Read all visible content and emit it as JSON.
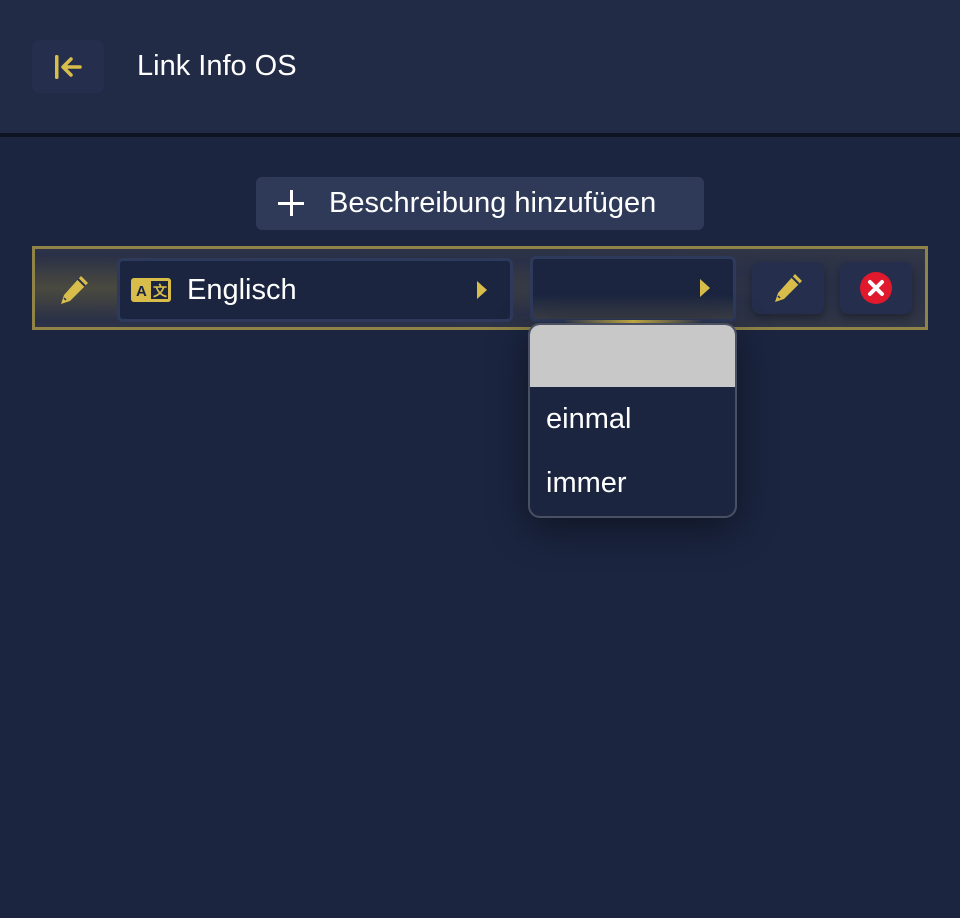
{
  "header": {
    "title": "Link Info OS",
    "back_icon": "collapse-left-arrow-icon"
  },
  "toolbar": {
    "add_description_label": "Beschreibung hinzufügen"
  },
  "entry": {
    "language": "Englisch",
    "language_icon": "translate-icon",
    "frequency_value": "",
    "edit_icon": "pencil-icon",
    "delete_icon": "close-circle-icon"
  },
  "dropdown": {
    "options": [
      "",
      "einmal",
      "immer"
    ],
    "highlighted": ""
  },
  "colors": {
    "accent": "#d8bd4a",
    "background": "#1b2540",
    "header": "#222b46",
    "delete": "#e0192d"
  }
}
